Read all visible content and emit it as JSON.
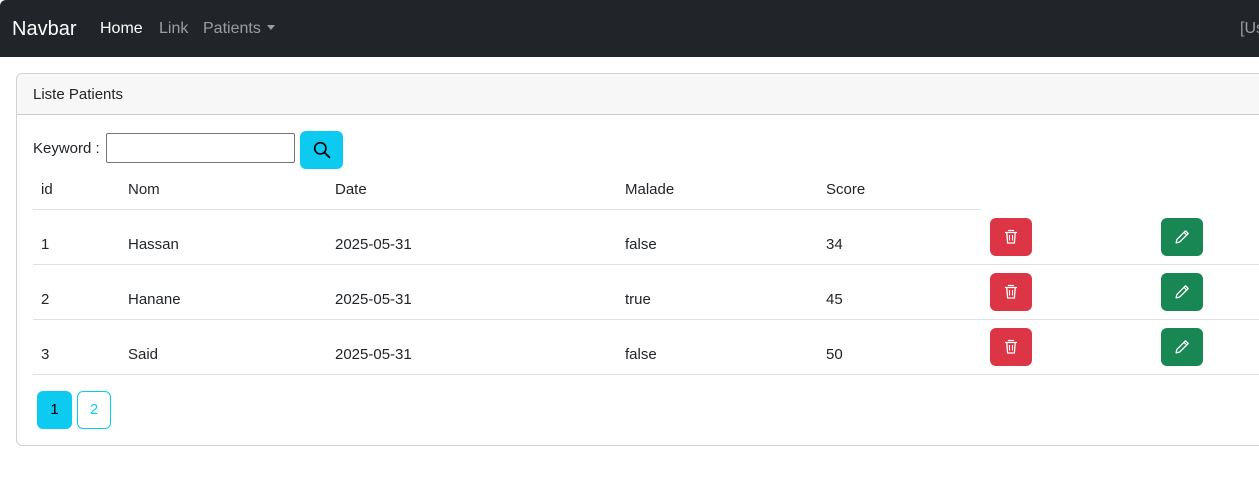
{
  "navbar": {
    "brand": "Navbar",
    "links": [
      {
        "label": "Home",
        "active": true
      },
      {
        "label": "Link",
        "active": false
      },
      {
        "label": "Patients",
        "active": false,
        "dropdown": true
      }
    ],
    "user": "[Us"
  },
  "card": {
    "title": "Liste Patients"
  },
  "search": {
    "label": "Keyword :",
    "value": "",
    "button_icon": "search-icon"
  },
  "table": {
    "columns": [
      "id",
      "Nom",
      "Date",
      "Malade",
      "Score"
    ],
    "rows": [
      {
        "id": "1",
        "nom": "Hassan",
        "date": "2025-05-31",
        "malade": "false",
        "score": "34"
      },
      {
        "id": "2",
        "nom": "Hanane",
        "date": "2025-05-31",
        "malade": "true",
        "score": "45"
      },
      {
        "id": "3",
        "nom": "Said",
        "date": "2025-05-31",
        "malade": "false",
        "score": "50"
      }
    ],
    "delete_icon": "trash-icon",
    "edit_icon": "pencil-icon"
  },
  "pagination": {
    "pages": [
      "1",
      "2"
    ],
    "current": "1"
  },
  "colors": {
    "navbar_bg": "#212529",
    "info": "#0dcaf0",
    "danger": "#dc3545",
    "success": "#198754"
  }
}
